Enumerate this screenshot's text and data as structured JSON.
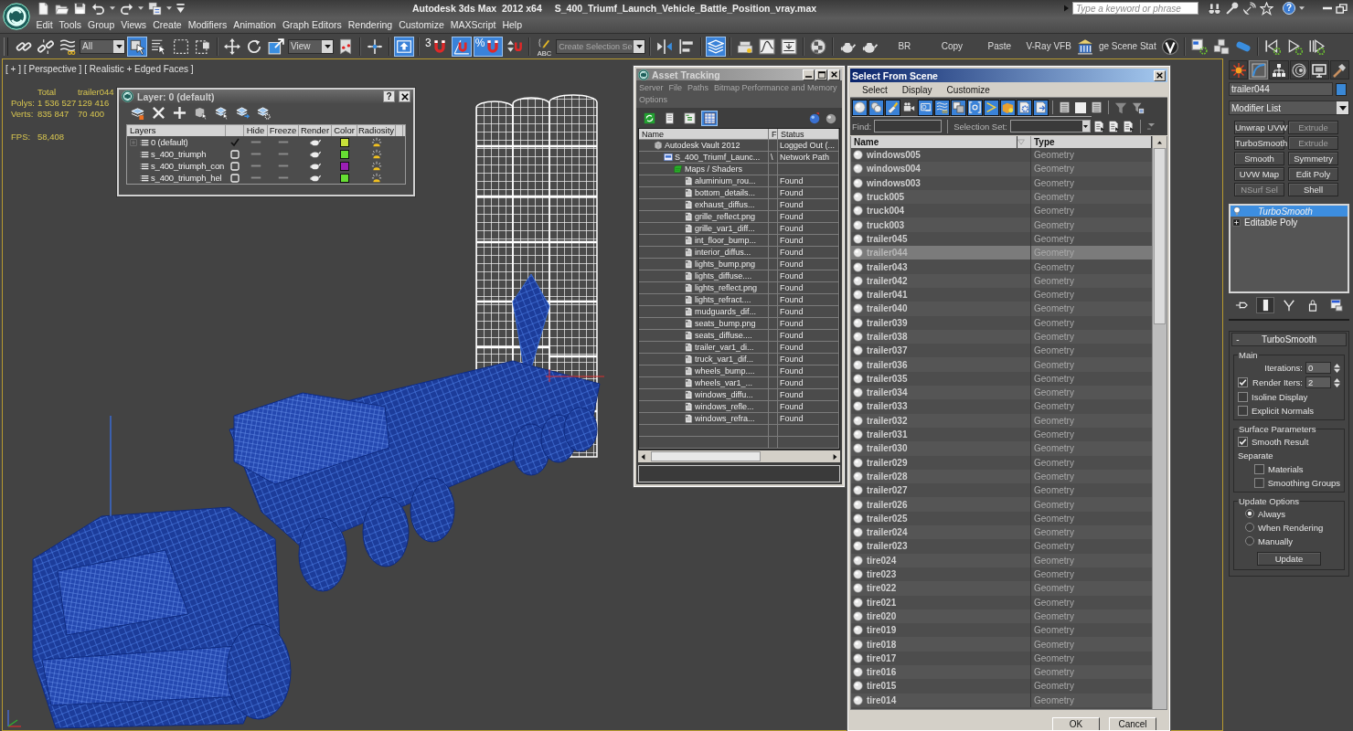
{
  "title_bar": {
    "app_title": "Autodesk 3ds Max  2012 x64",
    "file_name": "S_400_Triumf_Launch_Vehicle_Battle_Position_vray.max",
    "search": {
      "placeholder": "Type a keyword or phrase"
    },
    "help_label": "?"
  },
  "menu_bar": [
    "Edit",
    "Tools",
    "Group",
    "Views",
    "Create",
    "Modifiers",
    "Animation",
    "Graph Editors",
    "Rendering",
    "Customize",
    "MAXScript",
    "Help"
  ],
  "main_toolbar": [
    {
      "kind": "button",
      "selected": false
    },
    {
      "kind": "button",
      "selected": false
    },
    {
      "kind": "button",
      "selected": false
    },
    {
      "kind": "dropdown",
      "value": "All"
    },
    {
      "kind": "button",
      "selected": true
    },
    {
      "kind": "button",
      "selected": false
    },
    {
      "kind": "button",
      "selected": false
    },
    {
      "kind": "button",
      "selected": false
    },
    {
      "kind": "separator"
    },
    {
      "kind": "button",
      "selected": false
    },
    {
      "kind": "button",
      "selected": false
    },
    {
      "kind": "button",
      "selected": false
    },
    {
      "kind": "dropdown",
      "value": "View"
    },
    {
      "kind": "button",
      "selected": false
    },
    {
      "kind": "separator"
    },
    {
      "kind": "button",
      "selected": false
    },
    {
      "kind": "separator"
    },
    {
      "kind": "button",
      "selected": true
    },
    {
      "kind": "separator"
    },
    {
      "kind": "button",
      "selected": false,
      "label": "3"
    },
    {
      "kind": "button",
      "selected": true
    },
    {
      "kind": "button",
      "selected": true,
      "label": "%"
    },
    {
      "kind": "button",
      "selected": false
    },
    {
      "kind": "separator"
    },
    {
      "kind": "button",
      "selected": false,
      "label": "ABC"
    },
    {
      "kind": "dropdown",
      "value": "Create Selection Se"
    },
    {
      "kind": "separator"
    },
    {
      "kind": "button",
      "selected": false
    },
    {
      "kind": "button",
      "selected": false
    },
    {
      "kind": "separator"
    },
    {
      "kind": "button",
      "selected": true
    },
    {
      "kind": "separator"
    },
    {
      "kind": "button",
      "selected": false
    },
    {
      "kind": "button",
      "selected": false
    },
    {
      "kind": "button",
      "selected": false
    },
    {
      "kind": "separator"
    },
    {
      "kind": "button",
      "selected": false
    },
    {
      "kind": "separator"
    },
    {
      "kind": "button",
      "selected": false
    },
    {
      "kind": "button",
      "selected": false
    },
    {
      "kind": "text",
      "label": "BR"
    },
    {
      "kind": "text",
      "label": "Copy"
    },
    {
      "kind": "text",
      "label": "Paste"
    },
    {
      "kind": "text",
      "label": "V-Ray VFB"
    },
    {
      "kind": "button",
      "selected": false
    },
    {
      "kind": "text",
      "label": "ge Scene Stat"
    },
    {
      "kind": "button",
      "selected": false
    },
    {
      "kind": "separator"
    },
    {
      "kind": "button",
      "selected": false
    },
    {
      "kind": "button",
      "selected": false
    },
    {
      "kind": "button",
      "selected": false
    },
    {
      "kind": "separator"
    },
    {
      "kind": "button",
      "selected": false
    },
    {
      "kind": "button",
      "selected": false
    },
    {
      "kind": "button",
      "selected": false
    }
  ],
  "viewport": {
    "labels": [
      "[ + ]",
      "[ Perspective ]",
      "[ Realistic + Edged Faces ]"
    ],
    "stats": {
      "columns": [
        "Total",
        "trailer044"
      ],
      "rows": [
        {
          "label": "Polys:",
          "values": [
            "1 536 527",
            "129 416"
          ]
        },
        {
          "label": "Verts:",
          "values": [
            "835 847",
            "70 400"
          ]
        }
      ],
      "fps_label": "FPS:",
      "fps_value": "58,408"
    }
  },
  "layer_dialog": {
    "title": "Layer: 0 (default)",
    "help_label": "?",
    "columns": [
      "Layers",
      "Hide",
      "Freeze",
      "Render",
      "Color",
      "Radiosity"
    ],
    "layers": [
      {
        "name": "0 (default)",
        "expandable": true,
        "current": true,
        "hidden": false,
        "frozen": false,
        "renderable": true,
        "radiosity": true,
        "color": "#c8e03a"
      },
      {
        "name": "s_400_triumph",
        "expandable": false,
        "current": false,
        "hidden": false,
        "frozen": false,
        "renderable": true,
        "radiosity": true,
        "color": "#66dd33"
      },
      {
        "name": "s_400_triumph_con",
        "expandable": false,
        "current": false,
        "hidden": false,
        "frozen": false,
        "renderable": true,
        "radiosity": true,
        "color": "#9b1fb5"
      },
      {
        "name": "s_400_triumph_hel",
        "expandable": false,
        "current": false,
        "hidden": false,
        "frozen": false,
        "renderable": true,
        "radiosity": true,
        "color": "#66dd33"
      }
    ]
  },
  "asset_tracking": {
    "title": "Asset Tracking",
    "menu": [
      "Server",
      "File",
      "Paths",
      "Bitmap Performance and Memory",
      "Options"
    ],
    "toolbar": [
      {
        "selected": false
      },
      {
        "selected": false
      },
      {
        "selected": false
      },
      {
        "selected": true
      }
    ],
    "columns": [
      "Name",
      "F",
      "Status"
    ],
    "tree": [
      {
        "name": "Autodesk Vault 2012",
        "kind": "vault",
        "status": "Logged Out (...",
        "children": [
          {
            "name": "S_400_Triumf_Launc...",
            "kind": "scene",
            "column_2": "\\",
            "status": "Network Path",
            "children": [
              {
                "name": "Maps / Shaders",
                "kind": "folder",
                "children": [
                  {
                    "name": "aluminium_rou...",
                    "kind": "bitmap",
                    "status": "Found"
                  },
                  {
                    "name": "bottom_details...",
                    "kind": "bitmap",
                    "status": "Found"
                  },
                  {
                    "name": "exhaust_diffus...",
                    "kind": "bitmap",
                    "status": "Found"
                  },
                  {
                    "name": "grille_reflect.png",
                    "kind": "bitmap",
                    "status": "Found"
                  },
                  {
                    "name": "grille_var1_diff...",
                    "kind": "bitmap",
                    "status": "Found"
                  },
                  {
                    "name": "int_floor_bump...",
                    "kind": "bitmap",
                    "status": "Found"
                  },
                  {
                    "name": "interior_diffus...",
                    "kind": "bitmap",
                    "status": "Found"
                  },
                  {
                    "name": "lights_bump.png",
                    "kind": "bitmap",
                    "status": "Found"
                  },
                  {
                    "name": "lights_diffuse....",
                    "kind": "bitmap",
                    "status": "Found"
                  },
                  {
                    "name": "lights_reflect.png",
                    "kind": "bitmap",
                    "status": "Found"
                  },
                  {
                    "name": "lights_refract....",
                    "kind": "bitmap",
                    "status": "Found"
                  },
                  {
                    "name": "mudguards_dif...",
                    "kind": "bitmap",
                    "status": "Found"
                  },
                  {
                    "name": "seats_bump.png",
                    "kind": "bitmap",
                    "status": "Found"
                  },
                  {
                    "name": "seats_diffuse....",
                    "kind": "bitmap",
                    "status": "Found"
                  },
                  {
                    "name": "trailer_var1_di...",
                    "kind": "bitmap",
                    "status": "Found"
                  },
                  {
                    "name": "truck_var1_dif...",
                    "kind": "bitmap",
                    "status": "Found"
                  },
                  {
                    "name": "wheels_bump....",
                    "kind": "bitmap",
                    "status": "Found"
                  },
                  {
                    "name": "wheels_var1_...",
                    "kind": "bitmap",
                    "status": "Found"
                  },
                  {
                    "name": "windows_diffu...",
                    "kind": "bitmap",
                    "status": "Found"
                  },
                  {
                    "name": "windows_refle...",
                    "kind": "bitmap",
                    "status": "Found"
                  },
                  {
                    "name": "windows_refra...",
                    "kind": "bitmap",
                    "status": "Found"
                  }
                ]
              }
            ]
          }
        ]
      }
    ]
  },
  "select_from_scene": {
    "title": "Select From Scene",
    "menu": [
      "Select",
      "Display",
      "Customize"
    ],
    "filters": [
      {
        "selected": true
      },
      {
        "selected": true
      },
      {
        "selected": true
      },
      {
        "selected": false
      },
      {
        "selected": true
      },
      {
        "selected": true
      },
      {
        "selected": true
      },
      {
        "selected": true
      },
      {
        "selected": true
      },
      {
        "selected": true
      },
      {
        "selected": true
      },
      {
        "selected": true
      }
    ],
    "find_label": "Find:",
    "selection_set_label": "Selection Set:",
    "columns": [
      "Name",
      "Type"
    ],
    "objects": [
      {
        "name": "windows005",
        "type": "Geometry",
        "selected": false
      },
      {
        "name": "windows004",
        "type": "Geometry",
        "selected": false
      },
      {
        "name": "windows003",
        "type": "Geometry",
        "selected": false
      },
      {
        "name": "truck005",
        "type": "Geometry",
        "selected": false
      },
      {
        "name": "truck004",
        "type": "Geometry",
        "selected": false
      },
      {
        "name": "truck003",
        "type": "Geometry",
        "selected": false
      },
      {
        "name": "trailer045",
        "type": "Geometry",
        "selected": false
      },
      {
        "name": "trailer044",
        "type": "Geometry",
        "selected": true
      },
      {
        "name": "trailer043",
        "type": "Geometry",
        "selected": false
      },
      {
        "name": "trailer042",
        "type": "Geometry",
        "selected": false
      },
      {
        "name": "trailer041",
        "type": "Geometry",
        "selected": false
      },
      {
        "name": "trailer040",
        "type": "Geometry",
        "selected": false
      },
      {
        "name": "trailer039",
        "type": "Geometry",
        "selected": false
      },
      {
        "name": "trailer038",
        "type": "Geometry",
        "selected": false
      },
      {
        "name": "trailer037",
        "type": "Geometry",
        "selected": false
      },
      {
        "name": "trailer036",
        "type": "Geometry",
        "selected": false
      },
      {
        "name": "trailer035",
        "type": "Geometry",
        "selected": false
      },
      {
        "name": "trailer034",
        "type": "Geometry",
        "selected": false
      },
      {
        "name": "trailer033",
        "type": "Geometry",
        "selected": false
      },
      {
        "name": "trailer032",
        "type": "Geometry",
        "selected": false
      },
      {
        "name": "trailer031",
        "type": "Geometry",
        "selected": false
      },
      {
        "name": "trailer030",
        "type": "Geometry",
        "selected": false
      },
      {
        "name": "trailer029",
        "type": "Geometry",
        "selected": false
      },
      {
        "name": "trailer028",
        "type": "Geometry",
        "selected": false
      },
      {
        "name": "trailer027",
        "type": "Geometry",
        "selected": false
      },
      {
        "name": "trailer026",
        "type": "Geometry",
        "selected": false
      },
      {
        "name": "trailer025",
        "type": "Geometry",
        "selected": false
      },
      {
        "name": "trailer024",
        "type": "Geometry",
        "selected": false
      },
      {
        "name": "trailer023",
        "type": "Geometry",
        "selected": false
      },
      {
        "name": "tire024",
        "type": "Geometry",
        "selected": false
      },
      {
        "name": "tire023",
        "type": "Geometry",
        "selected": false
      },
      {
        "name": "tire022",
        "type": "Geometry",
        "selected": false
      },
      {
        "name": "tire021",
        "type": "Geometry",
        "selected": false
      },
      {
        "name": "tire020",
        "type": "Geometry",
        "selected": false
      },
      {
        "name": "tire019",
        "type": "Geometry",
        "selected": false
      },
      {
        "name": "tire018",
        "type": "Geometry",
        "selected": false
      },
      {
        "name": "tire017",
        "type": "Geometry",
        "selected": false
      },
      {
        "name": "tire016",
        "type": "Geometry",
        "selected": false
      },
      {
        "name": "tire015",
        "type": "Geometry",
        "selected": false
      },
      {
        "name": "tire014",
        "type": "Geometry",
        "selected": false
      }
    ],
    "buttons": [
      "OK",
      "Cancel"
    ]
  },
  "command_panel": {
    "tabs": [
      {
        "selected": false
      },
      {
        "selected": true
      },
      {
        "selected": false
      },
      {
        "selected": false
      },
      {
        "selected": false
      },
      {
        "selected": false
      }
    ],
    "object": {
      "name": "trailer044",
      "color": "#3a88d6"
    },
    "modifier_list": "Modifier List",
    "modifier_buttons": [
      {
        "label": "Unwrap UVW",
        "disabled": false
      },
      {
        "label": "Extrude",
        "disabled": true
      },
      {
        "label": "TurboSmooth",
        "disabled": false
      },
      {
        "label": "Extrude",
        "disabled": true
      },
      {
        "label": "Smooth",
        "disabled": false
      },
      {
        "label": "Symmetry",
        "disabled": false
      },
      {
        "label": "UVW Map",
        "disabled": false
      },
      {
        "label": "Edit Poly",
        "disabled": false
      },
      {
        "label": "NSurf Sel",
        "disabled": true
      },
      {
        "label": "Shell",
        "disabled": false
      }
    ],
    "stack": [
      {
        "name": "TurboSmooth",
        "kind": "modifier",
        "selected": true
      },
      {
        "name": "Editable Poly",
        "kind": "base",
        "selected": false
      }
    ],
    "stack_tools": [
      {
        "selected": false
      },
      {
        "selected": true
      },
      {
        "selected": false
      },
      {
        "selected": false
      },
      {
        "selected": false
      }
    ],
    "rollout": {
      "title": "TurboSmooth",
      "collapse_label": "-",
      "groups": [
        {
          "title": "Main",
          "controls": [
            {
              "kind": "spinner",
              "label": "Iterations:",
              "value": "0"
            },
            {
              "kind": "check_spinner",
              "label": "Render Iters:",
              "checked": true,
              "value": "2"
            },
            {
              "kind": "checkbox",
              "label": "Isoline Display",
              "checked": false
            },
            {
              "kind": "checkbox",
              "label": "Explicit Normals",
              "checked": false
            }
          ]
        },
        {
          "title": "Surface Parameters",
          "controls": [
            {
              "kind": "checkbox",
              "label": "Smooth Result",
              "checked": true
            },
            {
              "kind": "label",
              "label": "Separate",
              "children": [
                {
                  "kind": "checkbox",
                  "label": "Materials",
                  "checked": false
                },
                {
                  "kind": "checkbox",
                  "label": "Smoothing Groups",
                  "checked": false
                }
              ]
            }
          ]
        },
        {
          "title": "Update Options",
          "controls": [
            {
              "kind": "radio",
              "label": "Always",
              "selected": true
            },
            {
              "kind": "radio",
              "label": "When Rendering",
              "selected": false
            },
            {
              "kind": "radio",
              "label": "Manually",
              "selected": false
            },
            {
              "kind": "button",
              "label": "Update"
            }
          ]
        }
      ]
    }
  }
}
